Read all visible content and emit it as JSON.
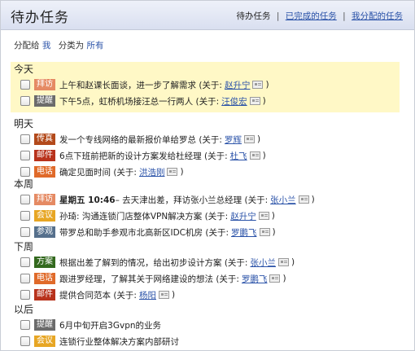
{
  "header": {
    "title": "待办任务",
    "links": {
      "current": "待办任务",
      "sep": "|",
      "completed": "已完成的任务",
      "assigned": "我分配的任务"
    }
  },
  "filters": {
    "assign_label": "分配给",
    "assign_value": "我",
    "category_label": "分类为",
    "category_value": "所有"
  },
  "about": {
    "prefix": "(关于:",
    "suffix": ")"
  },
  "colors": {
    "拜访": "#e58a63",
    "提醒": "#6b6b6b",
    "传真": "#b34a1b",
    "邮件": "#b8321c",
    "电话": "#e06a2a",
    "会议": "#e7a624",
    "参观": "#56708c",
    "方案": "#33691e"
  },
  "groups": [
    {
      "title": "今天",
      "highlight": true,
      "tasks": [
        {
          "tag": "拜访",
          "text": "上午和赵课长面谈，进一步了解需求",
          "who": "赵升宁"
        },
        {
          "tag": "提醒",
          "text": "下午5点，虹桥机场接汪总一行两人",
          "who": "汪俊宏"
        }
      ]
    },
    {
      "title": "明天",
      "highlight": false,
      "tasks": [
        {
          "tag": "传真",
          "text": "发一个专线网络的最新报价单给罗总",
          "who": "罗辉"
        },
        {
          "tag": "邮件",
          "text": "6点下班前把新的设计方案发给杜经理",
          "who": "杜飞"
        },
        {
          "tag": "电话",
          "text": "确定见面时间",
          "who": "洪浩刚"
        }
      ]
    },
    {
      "title": "本周",
      "highlight": false,
      "tasks": [
        {
          "tag": "拜访",
          "time": "星期五 10:46",
          "text": " – 去天津出差，拜访张小兰总经理",
          "who": "张小兰"
        },
        {
          "tag": "会议",
          "text": "孙琦: 沟通连锁门店整体VPN解决方案",
          "who": "赵升宁"
        },
        {
          "tag": "参观",
          "text": "带罗总和助手参观市北高新区IDC机房",
          "who": "罗鹏飞"
        }
      ]
    },
    {
      "title": "下周",
      "highlight": false,
      "tasks": [
        {
          "tag": "方案",
          "text": "根据出差了解到的情况，给出初步设计方案",
          "who": "张小兰"
        },
        {
          "tag": "电话",
          "text": "跟进罗经理，了解其关于网络建设的想法",
          "who": "罗鹏飞"
        },
        {
          "tag": "邮件",
          "text": "提供合同范本",
          "who": "杨阳"
        }
      ]
    },
    {
      "title": "以后",
      "highlight": false,
      "tasks": [
        {
          "tag": "提醒",
          "text": "6月中旬开启3Gvpn的业务"
        },
        {
          "tag": "会议",
          "text": "连锁行业整体解决方案内部研讨"
        }
      ]
    }
  ]
}
